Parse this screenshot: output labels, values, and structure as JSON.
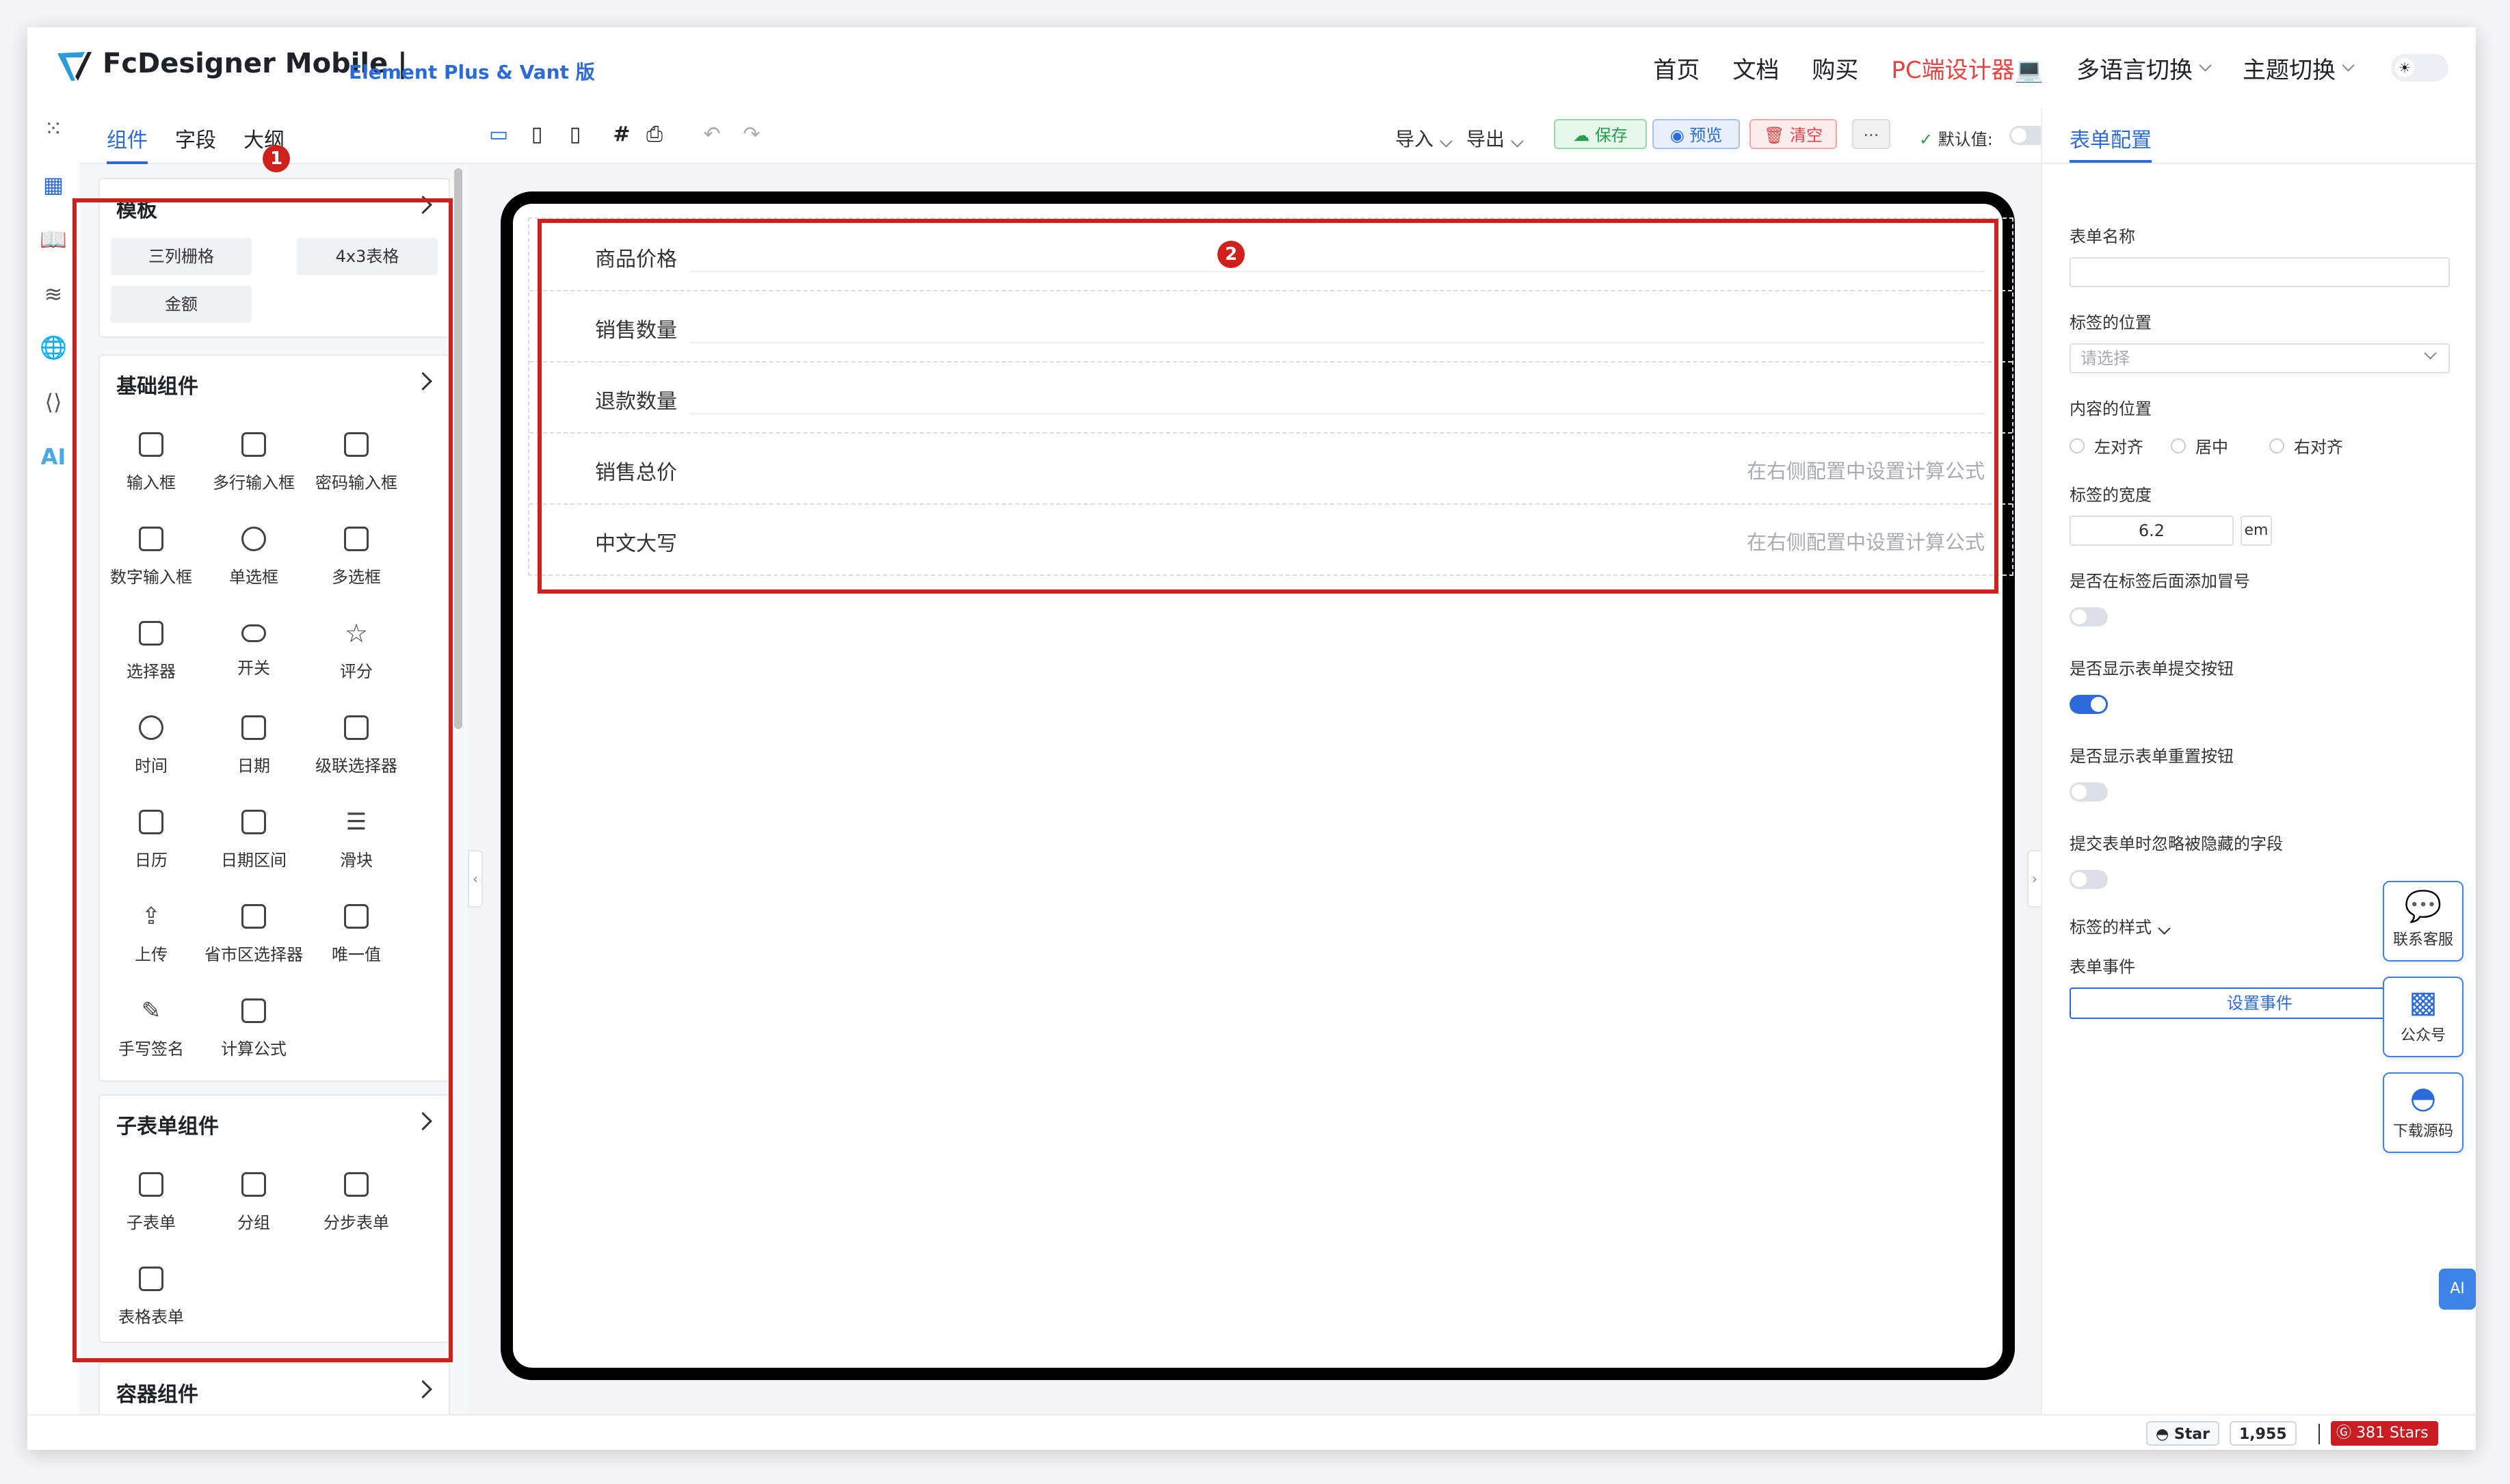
{
  "header": {
    "brand": "FcDesigner Mobile |",
    "brand_sub": "Element Plus & Vant 版",
    "nav": [
      "首页",
      "文档",
      "购买",
      "PC端设计器💻",
      "多语言切换",
      "主题切换"
    ]
  },
  "left_panel": {
    "tabs": [
      "组件",
      "字段",
      "大纲"
    ],
    "templates": {
      "title": "模板",
      "items": [
        "三列栅格",
        "4x3表格",
        "金额"
      ]
    },
    "basic": {
      "title": "基础组件",
      "items": [
        "输入框",
        "多行输入框",
        "密码输入框",
        "数字输入框",
        "单选框",
        "多选框",
        "选择器",
        "开关",
        "评分",
        "时间",
        "日期",
        "级联选择器",
        "日历",
        "日期区间",
        "滑块",
        "上传",
        "省市区选择器",
        "唯一值",
        "手写签名",
        "计算公式"
      ]
    },
    "subform": {
      "title": "子表单组件",
      "items": [
        "子表单",
        "分组",
        "分步表单",
        "表格表单"
      ]
    },
    "container": {
      "title": "容器组件"
    }
  },
  "toolbar": {
    "import": "导入",
    "export": "导出",
    "save": "保存",
    "preview": "预览",
    "clear": "清空",
    "more": "···",
    "default_value": "默认值:"
  },
  "canvas": {
    "rows": [
      {
        "label": "商品价格",
        "placeholder": ""
      },
      {
        "label": "销售数量",
        "placeholder": ""
      },
      {
        "label": "退款数量",
        "placeholder": ""
      },
      {
        "label": "销售总价",
        "placeholder": "在右侧配置中设置计算公式"
      },
      {
        "label": "中文大写",
        "placeholder": "在右侧配置中设置计算公式"
      }
    ]
  },
  "right_panel": {
    "tab": "表单配置",
    "form_name": "表单名称",
    "label_position": "标签的位置",
    "select_placeholder": "请选择",
    "content_position": "内容的位置",
    "align_options": [
      "左对齐",
      "居中",
      "右对齐"
    ],
    "label_width": "标签的宽度",
    "label_width_value": "6.2",
    "label_width_unit": "em",
    "colon_toggle": "是否在标签后面添加冒号",
    "submit_toggle": "是否显示表单提交按钮",
    "reset_toggle": "是否显示表单重置按钮",
    "ignore_hidden": "提交表单时忽略被隐藏的字段",
    "label_style": "标签的样式",
    "form_events": "表单事件",
    "set_events": "设置事件"
  },
  "floating": [
    "联系客服",
    "公众号",
    "下载源码"
  ],
  "ai_button": "AI",
  "rail_ai": "AI",
  "footer": {
    "star": "Star",
    "star_count": "1,955",
    "gitee": "381 Stars"
  },
  "annotations": [
    "1",
    "2"
  ],
  "colors": {
    "accent": "#2b6bd9",
    "annotation": "#d0201b",
    "danger": "#e84242",
    "success": "#22a04b"
  }
}
